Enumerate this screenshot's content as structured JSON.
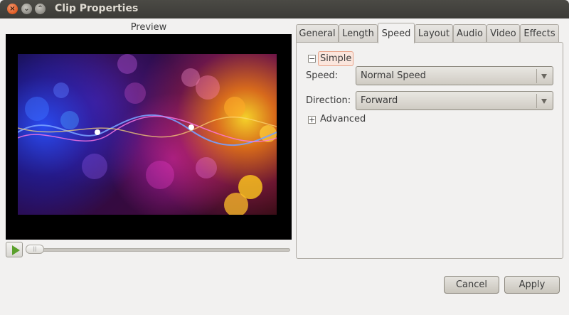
{
  "window": {
    "title": "Clip Properties"
  },
  "preview": {
    "label": "Preview"
  },
  "tabs": [
    "General",
    "Length",
    "Speed",
    "Layout",
    "Audio",
    "Video",
    "Effects"
  ],
  "active_tab": "Speed",
  "simple": {
    "expander_symbol": "−",
    "label": "Simple"
  },
  "speed": {
    "label": "Speed:",
    "value": "Normal Speed"
  },
  "direction": {
    "label": "Direction:",
    "value": "Forward"
  },
  "advanced": {
    "expander_symbol": "+",
    "label": "Advanced"
  },
  "buttons": {
    "cancel": "Cancel",
    "apply": "Apply"
  },
  "colors": {
    "accent_play": "#5aa02c",
    "close_button": "#e05a22",
    "titlebar": "#3c3b37"
  }
}
